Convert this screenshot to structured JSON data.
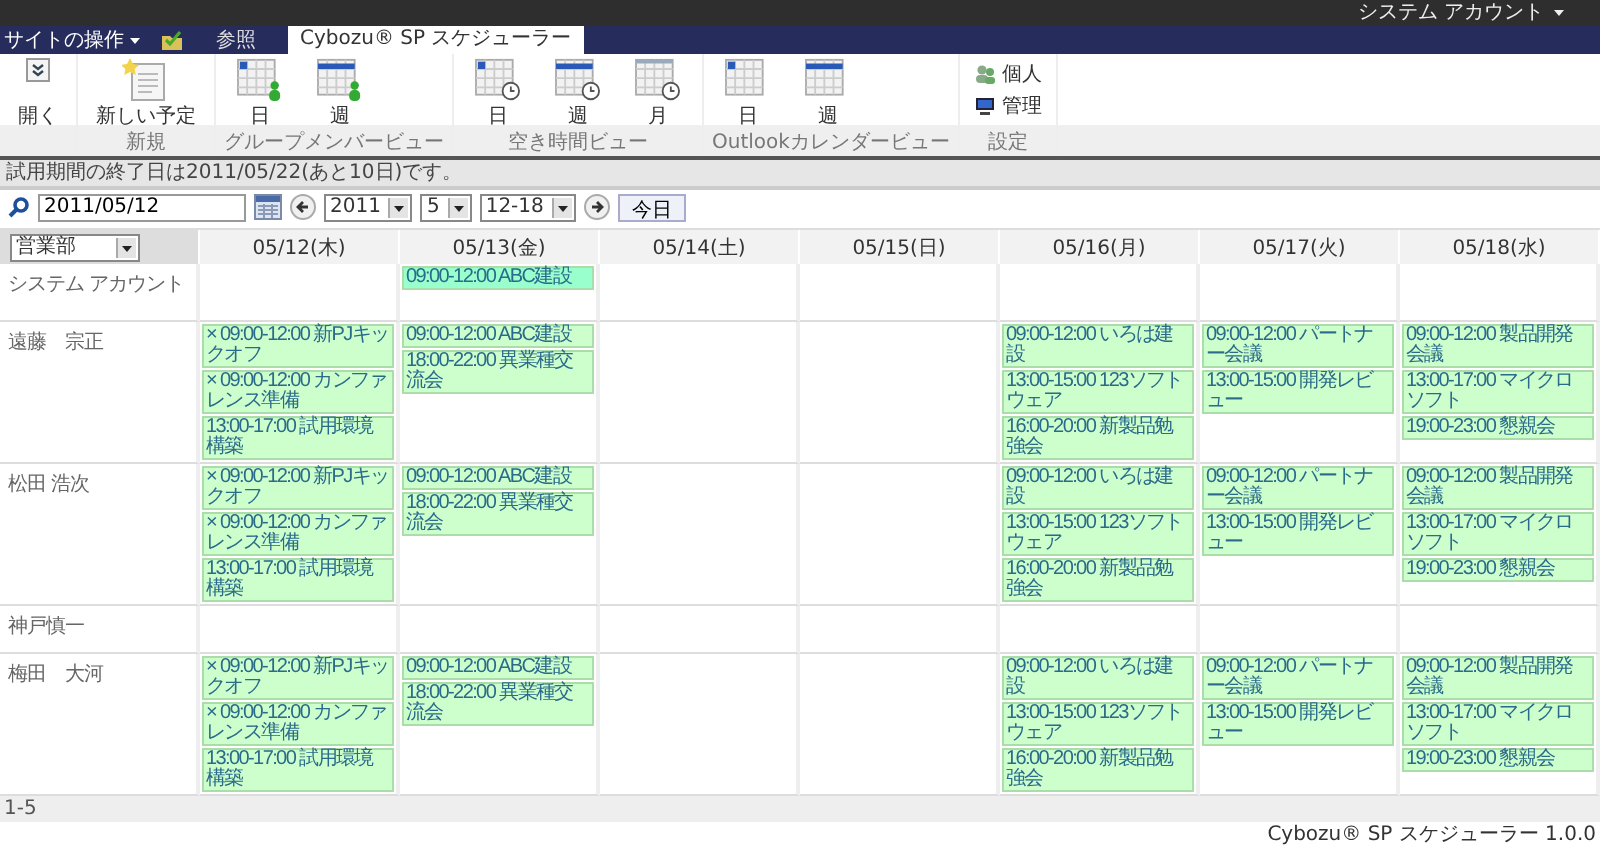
{
  "top_bar": {
    "user": "システム アカウント"
  },
  "nav": {
    "site_actions": "サイトの操作",
    "tabs": [
      {
        "label": "参照",
        "selected": false
      },
      {
        "label": "Cybozu® SP スケジューラー",
        "selected": true
      }
    ]
  },
  "ribbon": {
    "groups": [
      {
        "buttons": [
          {
            "label": "開く",
            "kind": "expand"
          }
        ]
      },
      {
        "label": "新規",
        "buttons": [
          {
            "label": "新しい予定",
            "kind": "new-event"
          }
        ]
      },
      {
        "label": "グループメンバービュー",
        "buttons": [
          {
            "label": "日",
            "kind": "day-people"
          },
          {
            "label": "週",
            "kind": "week-people"
          }
        ]
      },
      {
        "label": "空き時間ビュー",
        "buttons": [
          {
            "label": "日",
            "kind": "day-clock"
          },
          {
            "label": "週",
            "kind": "week-clock"
          },
          {
            "label": "月",
            "kind": "month-clock"
          }
        ]
      },
      {
        "label": "Outlookカレンダービュー",
        "buttons": [
          {
            "label": "日",
            "kind": "day"
          },
          {
            "label": "週",
            "kind": "week"
          }
        ]
      },
      {
        "label": "設定",
        "buttons": [
          {
            "label": "個人",
            "kind": "person"
          },
          {
            "label": "管理",
            "kind": "admin"
          }
        ]
      }
    ]
  },
  "message": "試用期間の終了日は2011/05/22(あと10日)です。",
  "toolbar": {
    "date": "2011/05/12",
    "year": "2011",
    "month": "5",
    "week": "12-18",
    "today": "今日"
  },
  "grid": {
    "department": "営業部",
    "days": [
      "05/12(木)",
      "05/13(金)",
      "05/14(土)",
      "05/15(日)",
      "05/16(月)",
      "05/17(火)",
      "05/18(水)"
    ],
    "rows": [
      {
        "name": "システム アカウント",
        "cells": [
          [],
          [
            {
              "text": "09:00-12:00 ABC建設",
              "color": "#99ffcc"
            }
          ],
          [],
          [],
          [],
          [],
          []
        ]
      },
      {
        "name": "遠藤　宗正",
        "cells": [
          [
            {
              "text": "× 09:00-12:00 新PJキックオフ",
              "color": "#ccffcc"
            },
            {
              "text": "× 09:00-12:00 カンファレンス準備",
              "color": "#ccffcc"
            },
            {
              "text": "13:00-17:00 試用環境構築",
              "color": "#ccffcc"
            }
          ],
          [
            {
              "text": "09:00-12:00 ABC建設",
              "color": "#ccffcc"
            },
            {
              "text": "18:00-22:00 異業種交流会",
              "color": "#ccffcc"
            }
          ],
          [],
          [],
          [
            {
              "text": "09:00-12:00 いろは建設",
              "color": "#ccffcc"
            },
            {
              "text": "13:00-15:00 123ソフトウェア",
              "color": "#ccffcc"
            },
            {
              "text": "16:00-20:00 新製品勉強会",
              "color": "#ccffcc"
            }
          ],
          [
            {
              "text": "09:00-12:00 パートナー会議",
              "color": "#ccffcc"
            },
            {
              "text": "13:00-15:00 開発レビュー",
              "color": "#ccffcc"
            }
          ],
          [
            {
              "text": "09:00-12:00 製品開発会議",
              "color": "#ccffcc"
            },
            {
              "text": "13:00-17:00 マイクロソフト",
              "color": "#ccffcc"
            },
            {
              "text": "19:00-23:00 懇親会",
              "color": "#ccffcc"
            }
          ]
        ]
      },
      {
        "name": "松田 浩次",
        "cells": [
          [
            {
              "text": "× 09:00-12:00 新PJキックオフ",
              "color": "#ccffcc"
            },
            {
              "text": "× 09:00-12:00 カンファレンス準備",
              "color": "#ccffcc"
            },
            {
              "text": "13:00-17:00 試用環境構築",
              "color": "#ccffcc"
            }
          ],
          [
            {
              "text": "09:00-12:00 ABC建設",
              "color": "#ccffcc"
            },
            {
              "text": "18:00-22:00 異業種交流会",
              "color": "#ccffcc"
            }
          ],
          [],
          [],
          [
            {
              "text": "09:00-12:00 いろは建設",
              "color": "#ccffcc"
            },
            {
              "text": "13:00-15:00 123ソフトウェア",
              "color": "#ccffcc"
            },
            {
              "text": "16:00-20:00 新製品勉強会",
              "color": "#ccffcc"
            }
          ],
          [
            {
              "text": "09:00-12:00 パートナー会議",
              "color": "#ccffcc"
            },
            {
              "text": "13:00-15:00 開発レビュー",
              "color": "#ccffcc"
            }
          ],
          [
            {
              "text": "09:00-12:00 製品開発会議",
              "color": "#ccffcc"
            },
            {
              "text": "13:00-17:00 マイクロソフト",
              "color": "#ccffcc"
            },
            {
              "text": "19:00-23:00 懇親会",
              "color": "#ccffcc"
            }
          ]
        ]
      },
      {
        "name": "神戸慎一",
        "cells": [
          [],
          [],
          [],
          [],
          [],
          [],
          []
        ]
      },
      {
        "name": "梅田　大河",
        "cells": [
          [
            {
              "text": "× 09:00-12:00 新PJキックオフ",
              "color": "#ccffcc"
            },
            {
              "text": "× 09:00-12:00 カンファレンス準備",
              "color": "#ccffcc"
            },
            {
              "text": "13:00-17:00 試用環境構築",
              "color": "#ccffcc"
            }
          ],
          [
            {
              "text": "09:00-12:00 ABC建設",
              "color": "#ccffcc"
            },
            {
              "text": "18:00-22:00 異業種交流会",
              "color": "#ccffcc"
            }
          ],
          [],
          [],
          [
            {
              "text": "09:00-12:00 いろは建設",
              "color": "#ccffcc"
            },
            {
              "text": "13:00-15:00 123ソフトウェア",
              "color": "#ccffcc"
            },
            {
              "text": "16:00-20:00 新製品勉強会",
              "color": "#ccffcc"
            }
          ],
          [
            {
              "text": "09:00-12:00 パートナー会議",
              "color": "#ccffcc"
            },
            {
              "text": "13:00-15:00 開発レビュー",
              "color": "#ccffcc"
            }
          ],
          [
            {
              "text": "09:00-12:00 製品開発会議",
              "color": "#ccffcc"
            },
            {
              "text": "13:00-17:00 マイクロソフト",
              "color": "#ccffcc"
            },
            {
              "text": "19:00-23:00 懇親会",
              "color": "#ccffcc"
            }
          ]
        ]
      }
    ]
  },
  "footer": {
    "paging": "1-5",
    "version": "Cybozu® SP スケジューラー 1.0.0"
  }
}
